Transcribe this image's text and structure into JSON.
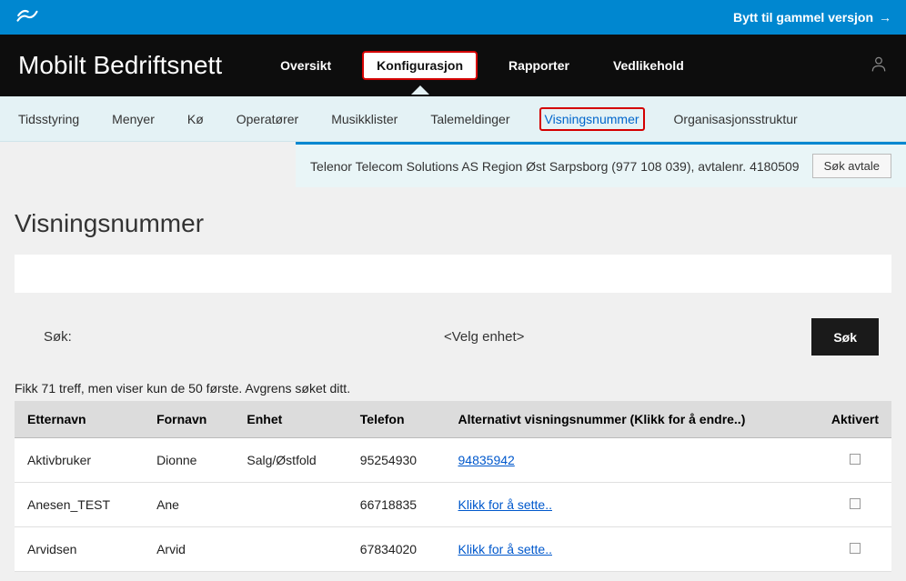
{
  "topbar": {
    "switch_link": "Bytt til gammel versjon"
  },
  "navbar": {
    "title": "Mobilt Bedriftsnett",
    "items": [
      "Oversikt",
      "Konfigurasjon",
      "Rapporter",
      "Vedlikehold"
    ]
  },
  "subnav": {
    "items": [
      "Tidsstyring",
      "Menyer",
      "Kø",
      "Operatører",
      "Musikklister",
      "Talemeldinger",
      "Visningsnummer",
      "Organisasjonsstruktur"
    ]
  },
  "banner": {
    "text": "Telenor Telecom Solutions AS Region Øst Sarpsborg (977 108 039), avtalenr. 4180509",
    "button": "Søk avtale"
  },
  "page": {
    "title": "Visningsnummer"
  },
  "search": {
    "label": "Søk:",
    "select_placeholder": "<Velg enhet>",
    "button": "Søk"
  },
  "results_note": "Fikk 71 treff, men viser kun de 50 første. Avgrens søket ditt.",
  "columns": {
    "etternavn": "Etternavn",
    "fornavn": "Fornavn",
    "enhet": "Enhet",
    "telefon": "Telefon",
    "alt": "Alternativt visningsnummer (Klikk for å endre..)",
    "aktivert": "Aktivert"
  },
  "rows": [
    {
      "etternavn": "Aktivbruker",
      "fornavn": "Dionne",
      "enhet": "Salg/Østfold",
      "telefon": "95254930",
      "alt": "94835942"
    },
    {
      "etternavn": "Anesen_TEST",
      "fornavn": "Ane",
      "enhet": "",
      "telefon": "66718835",
      "alt": "Klikk for å sette.."
    },
    {
      "etternavn": "Arvidsen",
      "fornavn": "Arvid",
      "enhet": "",
      "telefon": "67834020",
      "alt": "Klikk for å sette.."
    }
  ]
}
